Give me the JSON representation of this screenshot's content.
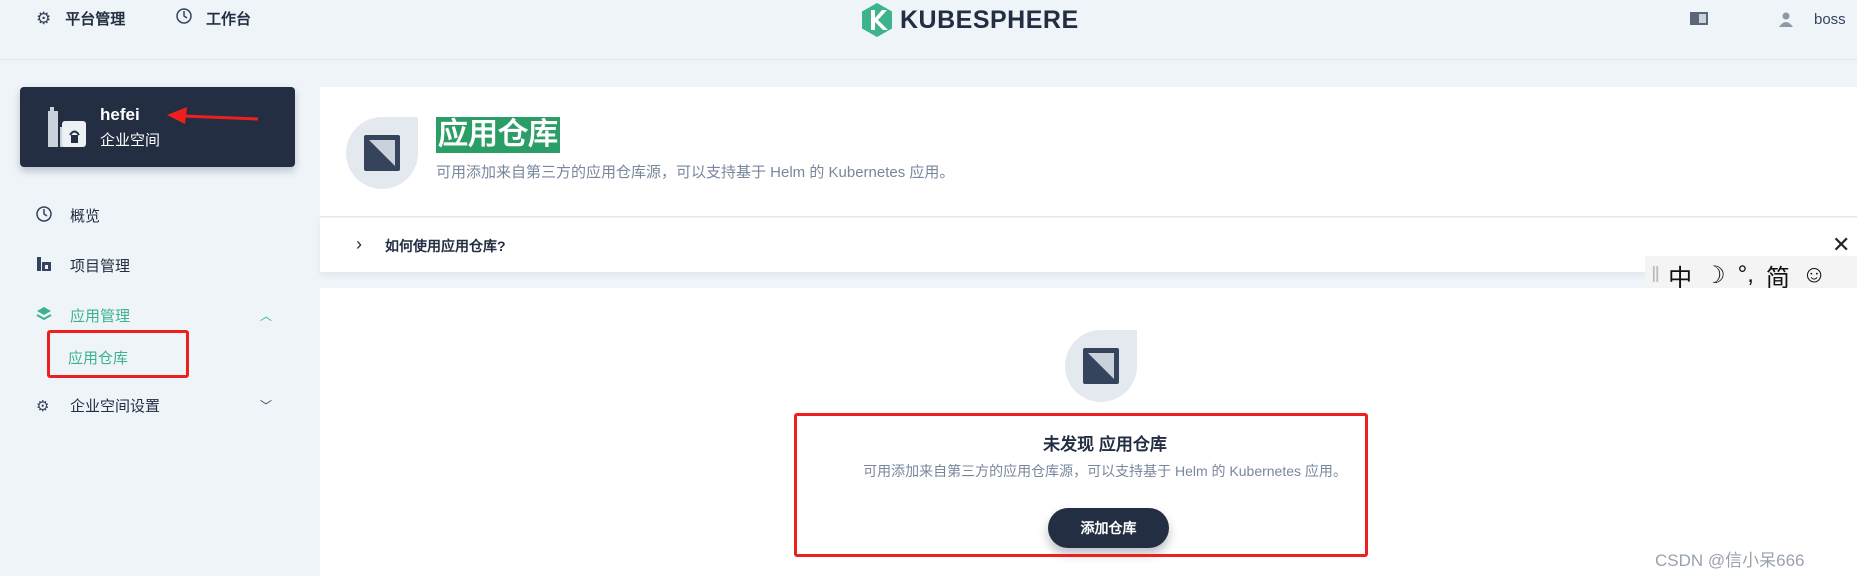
{
  "header": {
    "platform_label": "平台管理",
    "workbench_label": "工作台",
    "logo_text": "KUBESPHERE",
    "username": "boss"
  },
  "workspace": {
    "name": "hefei",
    "type": "企业空间"
  },
  "sidebar": {
    "items": [
      {
        "label": "概览",
        "icon": "dashboard-icon"
      },
      {
        "label": "项目管理",
        "icon": "project-icon"
      },
      {
        "label": "应用管理",
        "icon": "layers-icon",
        "active": true
      },
      {
        "label": "企业空间设置",
        "icon": "gear-icon"
      }
    ],
    "sub_item": "应用仓库"
  },
  "banner": {
    "title": "应用仓库",
    "description": "可用添加来自第三方的应用仓库源，可以支持基于 Helm 的 Kubernetes 应用。",
    "help": "如何使用应用仓库?"
  },
  "ime": {
    "items": [
      "中",
      "☽",
      "°,",
      "简",
      "☺"
    ]
  },
  "empty_state": {
    "title": "未发现 应用仓库",
    "description": "可用添加来自第三方的应用仓库源，可以支持基于 Helm 的 Kubernetes 应用。",
    "button": "添加仓库"
  },
  "watermark": "CSDN @信小呆666",
  "colors": {
    "accent_green": "#3cb38b",
    "dark": "#242e42",
    "annotation_red": "#ee1f1f"
  }
}
